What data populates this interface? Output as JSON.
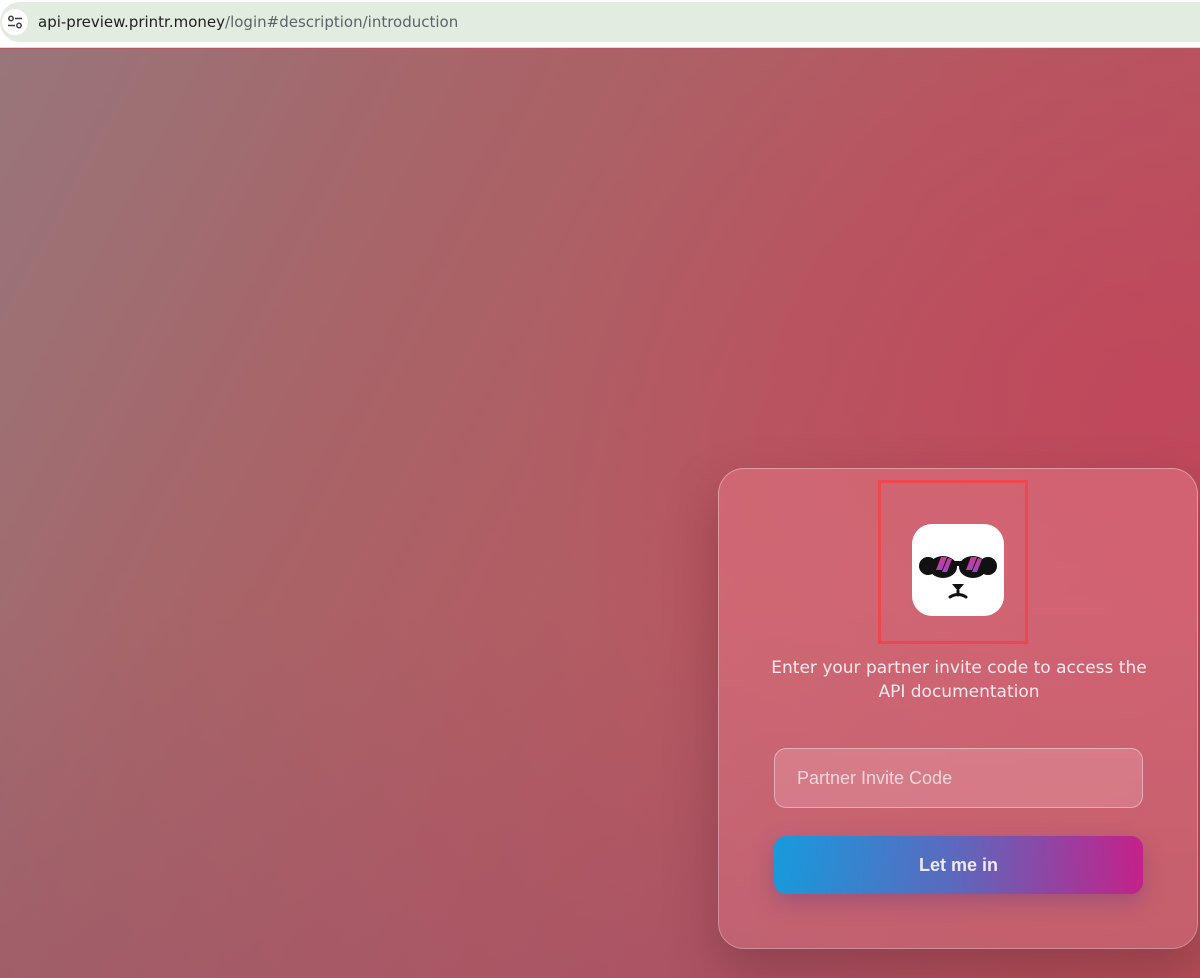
{
  "browser": {
    "url_host": "api-preview.printr.money",
    "url_path": "/login#description/introduction",
    "site_info_icon": "tune-icon"
  },
  "login": {
    "logo_icon": "panda-sunglasses-logo",
    "description": "Enter your partner invite code to access the API documentation",
    "invite_input": {
      "placeholder": "Partner Invite Code",
      "value": ""
    },
    "submit_label": "Let me in"
  },
  "colors": {
    "highlight_box": "#f0464e",
    "button_gradient_start": "#0aa6ec",
    "button_gradient_end": "#cf1c8c",
    "address_bar": "#e3ece0"
  }
}
